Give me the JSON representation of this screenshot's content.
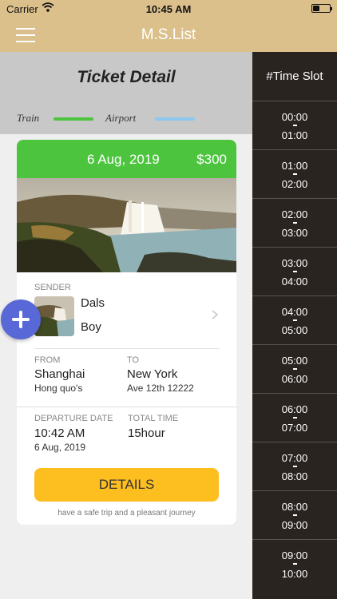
{
  "status": {
    "carrier": "Carrier",
    "time": "10:45 AM"
  },
  "nav": {
    "title": "M.S.List"
  },
  "ticket": {
    "heading": "Ticket Detail",
    "legend": [
      {
        "label": "Train",
        "color": "#4cc43e"
      },
      {
        "label": "Airport",
        "color": "#8cc8f0"
      }
    ],
    "date": "6 Aug, 2019",
    "price": "$300",
    "sender_label": "SENDER",
    "sender_first": "Dals",
    "sender_last": "Boy",
    "from_label": "FROM",
    "from_city": "Shanghai",
    "from_detail": "Hong quo's",
    "to_label": "TO",
    "to_city": "New York",
    "to_detail": "Ave 12th 12222",
    "departure_label": "DEPARTURE DATE",
    "departure_time": "10:42 AM",
    "departure_date": "6 Aug, 2019",
    "total_label": "TOTAL TIME",
    "total_value": "15hour",
    "details_button": "DETAILS",
    "footer": "have a safe trip and a pleasant journey"
  },
  "time_slots": {
    "header": "#Time Slot",
    "slots": [
      {
        "start": "00:00",
        "end": "01:00"
      },
      {
        "start": "01:00",
        "end": "02:00"
      },
      {
        "start": "02:00",
        "end": "03:00"
      },
      {
        "start": "03:00",
        "end": "04:00"
      },
      {
        "start": "04:00",
        "end": "05:00"
      },
      {
        "start": "05:00",
        "end": "06:00"
      },
      {
        "start": "06:00",
        "end": "07:00"
      },
      {
        "start": "07:00",
        "end": "08:00"
      },
      {
        "start": "08:00",
        "end": "09:00"
      },
      {
        "start": "09:00",
        "end": "10:00"
      }
    ]
  },
  "icons": {
    "menu": "hamburger-icon",
    "fab": "plus-icon",
    "chevron": "chevron-right-icon",
    "wifi": "wifi-icon",
    "battery": "battery-icon"
  },
  "colors": {
    "nav": "#dcc08c",
    "accent_green": "#4cc43e",
    "details_button": "#fdbe20",
    "fab": "#5968d7",
    "time_panel": "#2a2421"
  }
}
